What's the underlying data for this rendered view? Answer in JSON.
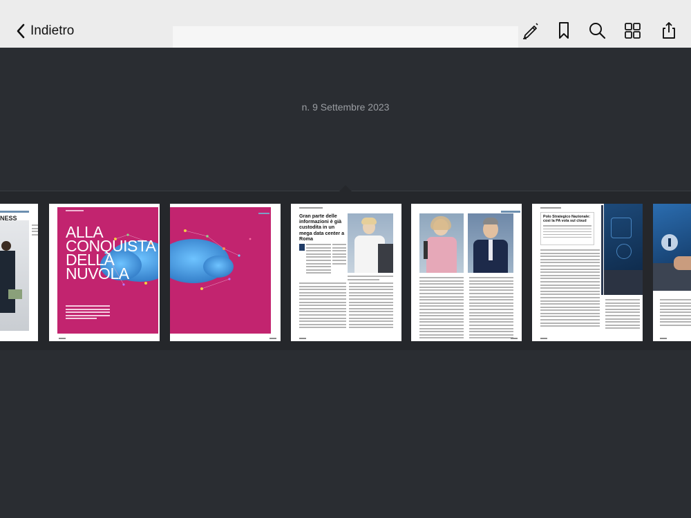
{
  "nav": {
    "back_label": "Indietro"
  },
  "toolbar": {
    "icons": [
      "pencil-icon",
      "bookmark-icon",
      "search-icon",
      "grid-icon",
      "share-icon"
    ]
  },
  "issue": {
    "title": "n. 9 Settembre 2023"
  },
  "pages": {
    "cover_story": {
      "headline_lines": [
        "ALLA",
        "CONQUISTA",
        "DELLA",
        "NUVOLA"
      ]
    },
    "article": {
      "headline": "Gran parte delle informazioni è già custodita in un mega data center a Roma"
    },
    "article_two": {
      "headline": "Polo Strategico Nazionale: così la PA vola sul cloud"
    }
  },
  "colors": {
    "topbar": "#ececec",
    "background": "#2a2d32",
    "strip": "#25272b",
    "magenta": "#c2246f",
    "cloud": "#3c8fd6"
  }
}
